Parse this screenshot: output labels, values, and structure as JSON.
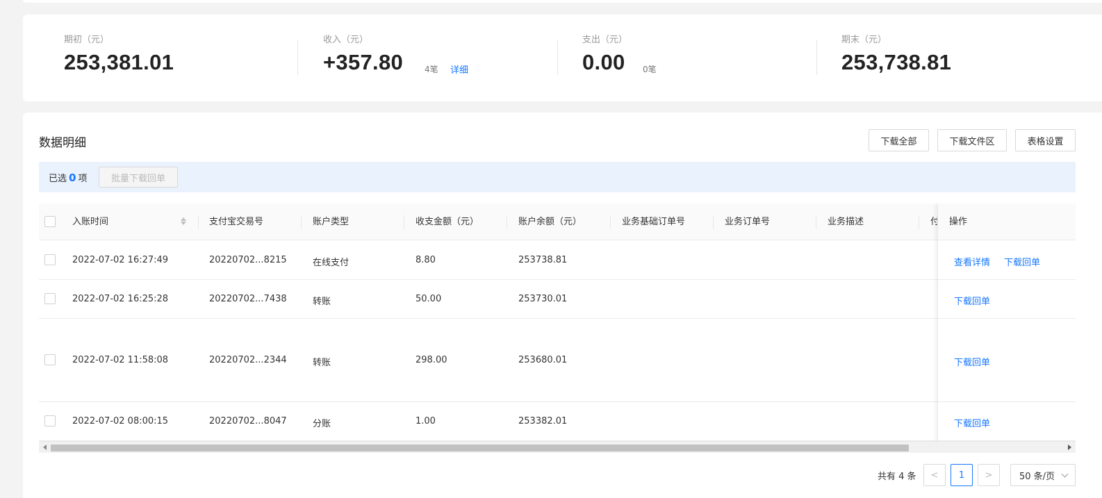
{
  "summary": {
    "opening": {
      "label": "期初（元）",
      "value": "253,381.01"
    },
    "income": {
      "label": "收入（元）",
      "value": "+357.80",
      "count": "4笔",
      "detail_link": "详细"
    },
    "expense": {
      "label": "支出（元）",
      "value": "0.00",
      "count": "0笔"
    },
    "closing": {
      "label": "期末（元）",
      "value": "253,738.81"
    }
  },
  "panel": {
    "title": "数据明细",
    "buttons": {
      "download_all": "下载全部",
      "download_files": "下载文件区",
      "table_settings": "表格设置"
    }
  },
  "selection": {
    "prefix": "已选",
    "count": "0",
    "suffix": "项",
    "batch_button": "批量下载回单"
  },
  "table": {
    "columns": [
      "入账时间",
      "支付宝交易号",
      "账户类型",
      "收支金额（元）",
      "账户余额（元）",
      "业务基础订单号",
      "业务订单号",
      "业务描述",
      "付"
    ],
    "action_column": "操作",
    "rows": [
      {
        "time": "2022-07-02 16:27:49",
        "trade_no": "20220702...8215",
        "type": "在线支付",
        "amount": "8.80",
        "balance": "253738.81",
        "actions": [
          "查看详情",
          "下载回单"
        ]
      },
      {
        "time": "2022-07-02 16:25:28",
        "trade_no": "20220702...7438",
        "type": "转账",
        "amount": "50.00",
        "balance": "253730.01",
        "actions": [
          "下载回单"
        ]
      },
      {
        "time": "2022-07-02 11:58:08",
        "trade_no": "20220702...2344",
        "type": "转账",
        "amount": "298.00",
        "balance": "253680.01",
        "actions": [
          "下载回单"
        ]
      },
      {
        "time": "2022-07-02 08:00:15",
        "trade_no": "20220702...8047",
        "type": "分账",
        "amount": "1.00",
        "balance": "253382.01",
        "actions": [
          "下载回单"
        ]
      }
    ]
  },
  "pagination": {
    "total": "共有 4 条",
    "prev": "<",
    "current": "1",
    "next": ">",
    "page_size": "50 条/页"
  },
  "colors": {
    "accent": "#1677ff",
    "selection_bar": "#eaf2fd"
  }
}
